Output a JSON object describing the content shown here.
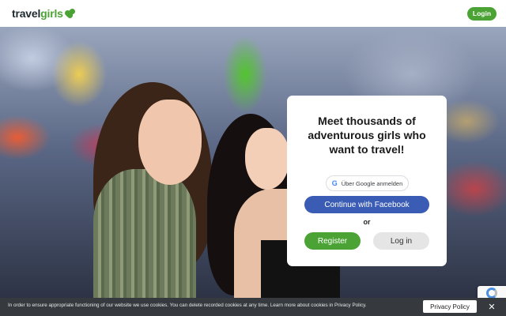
{
  "header": {
    "logo_part1": "travel",
    "logo_part2": "girls",
    "login_label": "Login"
  },
  "signup_card": {
    "title": "Meet thousands of adventurous girls who want to travel!",
    "google_label": "Über Google anmelden",
    "facebook_label": "Continue with Facebook",
    "or_label": "or",
    "register_label": "Register",
    "login_label": "Log in"
  },
  "cookie_bar": {
    "text": "In order to ensure appropriate functioning of our website we use cookies. You can delete recorded cookies at any time. Learn more about cookies in Privacy Policy.",
    "policy_button": "Privacy Policy",
    "close_label": "✕"
  },
  "colors": {
    "brand_green": "#4aa334",
    "facebook_blue": "#3b5cb4",
    "cookie_bar_bg": "#363a3f"
  },
  "icons": {
    "logo_icon": "clover-icon",
    "google_icon": "google-g-icon",
    "close_icon": "close-icon",
    "recaptcha_icon": "recaptcha-icon"
  }
}
